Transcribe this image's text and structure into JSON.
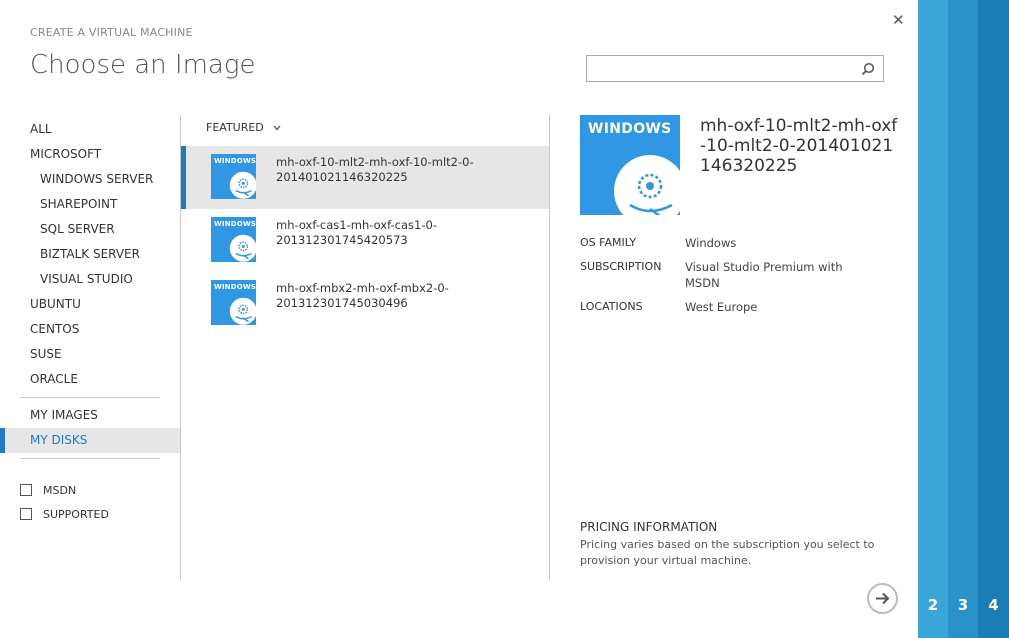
{
  "wizard": {
    "subtitle": "CREATE A VIRTUAL MACHINE",
    "title": "Choose an Image"
  },
  "search": {
    "placeholder": "",
    "value": ""
  },
  "nav": {
    "items": [
      {
        "label": "ALL",
        "level": 0
      },
      {
        "label": "MICROSOFT",
        "level": 0
      },
      {
        "label": "WINDOWS SERVER",
        "level": 1
      },
      {
        "label": "SHAREPOINT",
        "level": 1
      },
      {
        "label": "SQL SERVER",
        "level": 1
      },
      {
        "label": "BIZTALK SERVER",
        "level": 1
      },
      {
        "label": "VISUAL STUDIO",
        "level": 1
      },
      {
        "label": "UBUNTU",
        "level": 0
      },
      {
        "label": "CENTOS",
        "level": 0
      },
      {
        "label": "SUSE",
        "level": 0
      },
      {
        "label": "ORACLE",
        "level": 0
      }
    ],
    "my_items": [
      {
        "label": "MY IMAGES",
        "active": false
      },
      {
        "label": "MY DISKS",
        "active": true
      }
    ],
    "filters": [
      {
        "label": "MSDN",
        "checked": false
      },
      {
        "label": "SUPPORTED",
        "checked": false
      }
    ]
  },
  "list": {
    "header": "FEATURED",
    "thumb_label": "WINDOWS",
    "items": [
      {
        "name": "mh-oxf-10-mlt2-mh-oxf-10-mlt2-0-201401021146320225",
        "line1": "mh-oxf-10-mlt2-mh-oxf-10-mlt2-0-",
        "line2": "201401021146320225",
        "selected": true
      },
      {
        "name": "mh-oxf-cas1-mh-oxf-cas1-0-201312301745420573",
        "line1": "mh-oxf-cas1-mh-oxf-cas1-0-201312301745420573",
        "line2": "",
        "selected": false
      },
      {
        "name": "mh-oxf-mbx2-mh-oxf-mbx2-0-201312301745030496",
        "line1": "mh-oxf-mbx2-mh-oxf-mbx2-0-",
        "line2": "201312301745030496",
        "selected": false
      }
    ]
  },
  "detail": {
    "tile_label": "WINDOWS",
    "name": "mh-oxf-10-mlt2-mh-oxf-10-mlt2-0-201401021146320225",
    "os_family_label": "OS FAMILY",
    "os_family": "Windows",
    "subscription_label": "SUBSCRIPTION",
    "subscription": "Visual Studio Premium with MSDN",
    "locations_label": "LOCATIONS",
    "locations": "West Europe",
    "pricing_title": "PRICING INFORMATION",
    "pricing_text": "Pricing varies based on the subscription you select to provision your virtual machine."
  },
  "steps": [
    "2",
    "3",
    "4"
  ],
  "colors": {
    "accent": "#1e7bc2",
    "tile": "#2f97e3",
    "step2": "#3aa6d8",
    "step3": "#2a92c8",
    "step4": "#1a7db5"
  },
  "icons": {
    "close": "close-icon",
    "search": "search-icon",
    "chevron": "chevron-down-icon",
    "disc": "disc-icon",
    "next": "arrow-right-icon"
  }
}
